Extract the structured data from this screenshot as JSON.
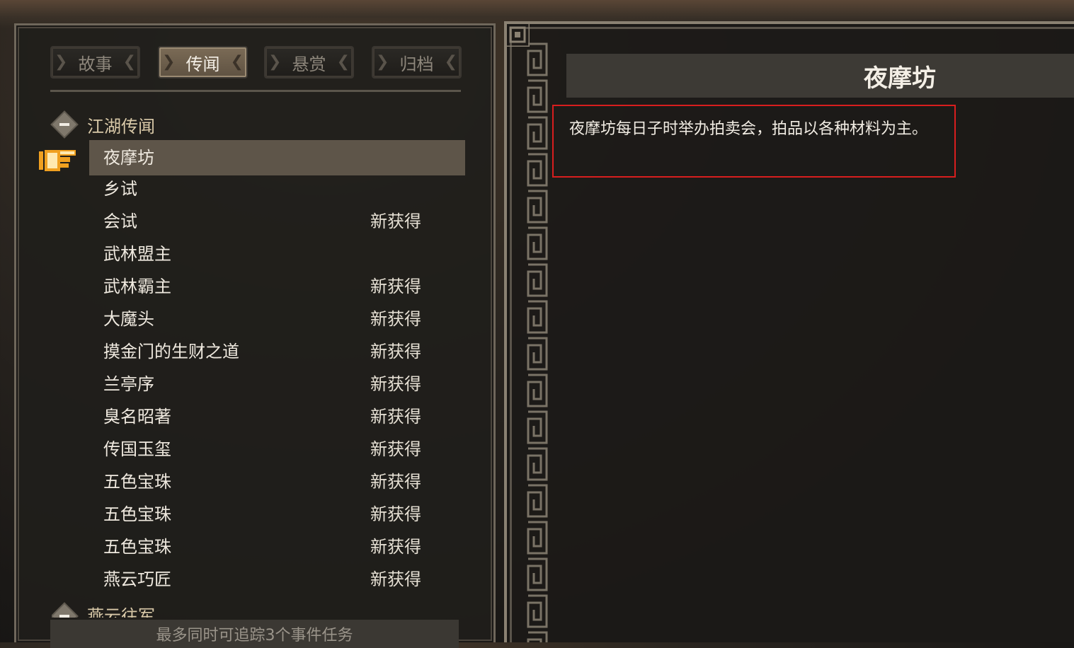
{
  "tabs": [
    {
      "label": "故事",
      "active": false
    },
    {
      "label": "传闻",
      "active": true
    },
    {
      "label": "悬赏",
      "active": false
    },
    {
      "label": "归档",
      "active": false
    }
  ],
  "sections": [
    {
      "label": "江湖传闻",
      "expanded": true
    },
    {
      "label": "燕云往军",
      "expanded": true
    }
  ],
  "list": {
    "items": [
      {
        "name": "夜摩坊",
        "badge": "",
        "selected": true
      },
      {
        "name": "乡试",
        "badge": ""
      },
      {
        "name": "会试",
        "badge": "新获得"
      },
      {
        "name": "武林盟主",
        "badge": ""
      },
      {
        "name": "武林霸主",
        "badge": "新获得"
      },
      {
        "name": "大魔头",
        "badge": "新获得"
      },
      {
        "name": "摸金门的生财之道",
        "badge": "新获得"
      },
      {
        "name": "兰亭序",
        "badge": "新获得"
      },
      {
        "name": "臭名昭著",
        "badge": "新获得"
      },
      {
        "name": "传国玉玺",
        "badge": "新获得"
      },
      {
        "name": "五色宝珠",
        "badge": "新获得"
      },
      {
        "name": "五色宝珠",
        "badge": "新获得"
      },
      {
        "name": "五色宝珠",
        "badge": "新获得"
      },
      {
        "name": "燕云巧匠",
        "badge": "新获得"
      }
    ]
  },
  "status": {
    "text": "最多同时可追踪3个事件任务"
  },
  "detail": {
    "title": "夜摩坊",
    "description": "夜摩坊每日子时举办拍卖会，拍品以各种材料为主。"
  },
  "colors": {
    "highlight_border": "#d81e1e",
    "selected_row": "#5e5549",
    "pointer": "#f0a020"
  }
}
